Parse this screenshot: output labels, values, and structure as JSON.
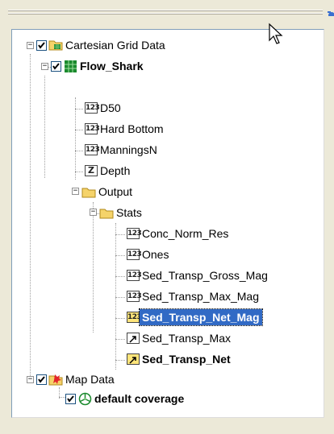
{
  "colors": {
    "selection": "#316ac5",
    "folder": "#f5d36a",
    "grid": "#1b8a2e"
  },
  "tree": {
    "cartesian_grid": {
      "label": "Cartesian Grid Data",
      "icon": "grid-folder-icon",
      "checked": true
    },
    "flow_shark": {
      "label": "Flow_Shark",
      "icon": "grid-icon",
      "checked": true
    },
    "datasets": [
      {
        "label": "D50",
        "icon": "scalar-dataset-icon",
        "badge": "123"
      },
      {
        "label": "Hard Bottom",
        "icon": "scalar-dataset-icon",
        "badge": "123"
      },
      {
        "label": "ManningsN",
        "icon": "scalar-dataset-icon",
        "badge": "123"
      },
      {
        "label": "Depth",
        "icon": "elevation-dataset-icon",
        "badge": "Z"
      }
    ],
    "output_folder": {
      "label": "Output",
      "icon": "folder-icon"
    },
    "stats_folder": {
      "label": "Stats",
      "icon": "folder-icon"
    },
    "stats_items": [
      {
        "label": "Conc_Norm_Res",
        "badge": "123"
      },
      {
        "label": "Ones",
        "badge": "123"
      },
      {
        "label": "Sed_Transp_Gross_Mag",
        "badge": "123"
      },
      {
        "label": "Sed_Transp_Max_Mag",
        "badge": "123"
      },
      {
        "label": "Sed_Transp_Net_Mag",
        "badge": "123",
        "selected": true
      },
      {
        "label": "Sed_Transp_Max",
        "icon": "vector-dataset-icon"
      },
      {
        "label": "Sed_Transp_Net",
        "icon": "vector-dataset-icon",
        "active": true
      }
    ],
    "map_data": {
      "label": "Map Data",
      "icon": "map-folder-icon",
      "checked": true
    },
    "default_coverage": {
      "label": "default coverage",
      "icon": "coverage-icon",
      "checked": true
    }
  }
}
